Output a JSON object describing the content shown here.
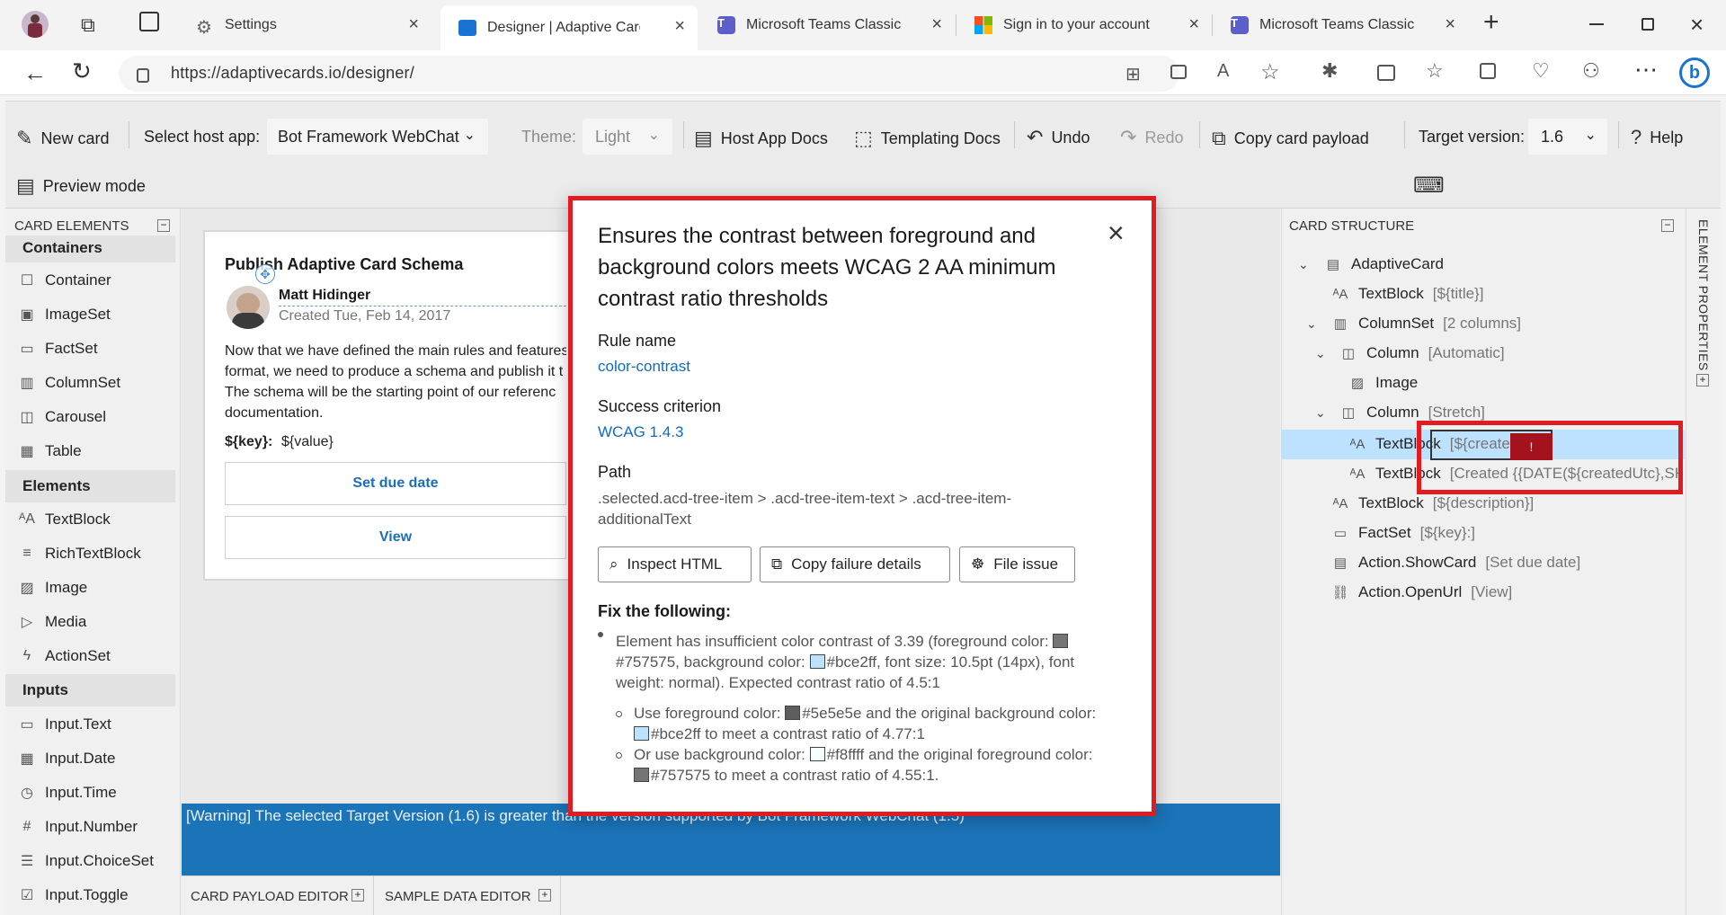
{
  "browser": {
    "tabs": [
      {
        "title": "Settings"
      },
      {
        "title": "Designer | Adaptive Card"
      },
      {
        "title": "Microsoft Teams Classic"
      },
      {
        "title": "Sign in to your account"
      },
      {
        "title": "Microsoft Teams Classic"
      }
    ],
    "new_tab": "+",
    "url": "https://adaptivecards.io/designer/"
  },
  "toolbar": {
    "new_card": "New card",
    "select_host_app_label": "Select host app:",
    "host_app_value": "Bot Framework WebChat",
    "theme_label": "Theme:",
    "theme_value": "Light",
    "host_app_docs": "Host App Docs",
    "templating_docs": "Templating Docs",
    "undo": "Undo",
    "redo": "Redo",
    "copy_card_payload": "Copy card payload",
    "target_version_label": "Target version:",
    "target_version_value": "1.6",
    "help": "Help",
    "preview_mode": "Preview mode"
  },
  "card_elements": {
    "header": "CARD ELEMENTS",
    "categories": [
      {
        "name": "Containers",
        "items": [
          "Container",
          "ImageSet",
          "FactSet",
          "ColumnSet",
          "Carousel",
          "Table"
        ]
      },
      {
        "name": "Elements",
        "items": [
          "TextBlock",
          "RichTextBlock",
          "Image",
          "Media",
          "ActionSet"
        ]
      },
      {
        "name": "Inputs",
        "items": [
          "Input.Text",
          "Input.Date",
          "Input.Time",
          "Input.Number",
          "Input.ChoiceSet",
          "Input.Toggle"
        ]
      }
    ]
  },
  "card_preview": {
    "title": "Publish Adaptive Card Schema",
    "author": "Matt Hidinger",
    "created": "Created Tue, Feb 14, 2017",
    "body_lines": [
      "Now that we have defined the main rules and features",
      "format, we need to produce a schema and publish it t",
      "The schema will be the starting point of our referenc",
      "documentation."
    ],
    "fact_key": "${key}:",
    "fact_value": "${value}",
    "action_1": "Set due date",
    "action_2": "View"
  },
  "warning": "[Warning] The selected Target Version (1.6) is greater than the version supported by Bot Framework WebChat (1.5)",
  "bottom_tabs": [
    "CARD PAYLOAD EDITOR",
    "SAMPLE DATA EDITOR"
  ],
  "card_structure": {
    "header": "CARD STRUCTURE",
    "side_label": "ELEMENT PROPERTIES",
    "items": [
      {
        "label": "AdaptiveCard",
        "sub": ""
      },
      {
        "label": "TextBlock",
        "sub": "[${title}]"
      },
      {
        "label": "ColumnSet",
        "sub": "[2 columns]"
      },
      {
        "label": "Column",
        "sub": "[Automatic]"
      },
      {
        "label": "Image",
        "sub": ""
      },
      {
        "label": "Column",
        "sub": "[Stretch]"
      },
      {
        "label": "TextBlock",
        "sub": "[${createdUtc}]"
      },
      {
        "label": "TextBlock",
        "sub": "[Created {{DATE(${createdUtc},SH"
      },
      {
        "label": "TextBlock",
        "sub": "[${description}]"
      },
      {
        "label": "FactSet",
        "sub": "[${key}:]"
      },
      {
        "label": "Action.ShowCard",
        "sub": "[Set due date]"
      },
      {
        "label": "Action.OpenUrl",
        "sub": "[View]"
      }
    ],
    "issue_marker": "!"
  },
  "dialog": {
    "title": "Ensures the contrast between foreground and background colors meets WCAG 2 AA minimum contrast ratio thresholds",
    "rule_name_label": "Rule name",
    "rule_name": "color-contrast",
    "success_label": "Success criterion",
    "success": "WCAG 1.4.3",
    "path_label": "Path",
    "path": ".selected.acd-tree-item > .acd-tree-item-text > .acd-tree-item-additionalText",
    "buttons": {
      "inspect": "Inspect HTML",
      "copy": "Copy failure details",
      "file": "File issue"
    },
    "fix_label": "Fix the following:",
    "issue_a": "Element has insufficient color contrast of 3.39 (foreground color:",
    "issue_b": "#757575, background color:",
    "issue_c": "#bce2ff, font size: 10.5pt (14px), font weight: normal). Expected contrast ratio of 4.5:1",
    "fix1_a": "Use foreground color:",
    "fix1_b": "#5e5e5e and the original background color:",
    "fix1_c": "#bce2ff to meet a contrast ratio of 4.77:1",
    "fix2_a": "Or use background color:",
    "fix2_b": "#f8ffff and the original foreground color:",
    "fix2_c": "#757575 to meet a contrast ratio of 4.55:1.",
    "swatches": {
      "c757575": "#757575",
      "cbce2ff": "#bce2ff",
      "c5e5e5e": "#5e5e5e",
      "cf8ffff": "#f8ffff"
    }
  },
  "colors": {
    "highlight_red": "#e01b22",
    "selection_blue": "#bce2ff",
    "link_blue": "#0f6cbd",
    "warning_bg": "#1b73b8"
  }
}
